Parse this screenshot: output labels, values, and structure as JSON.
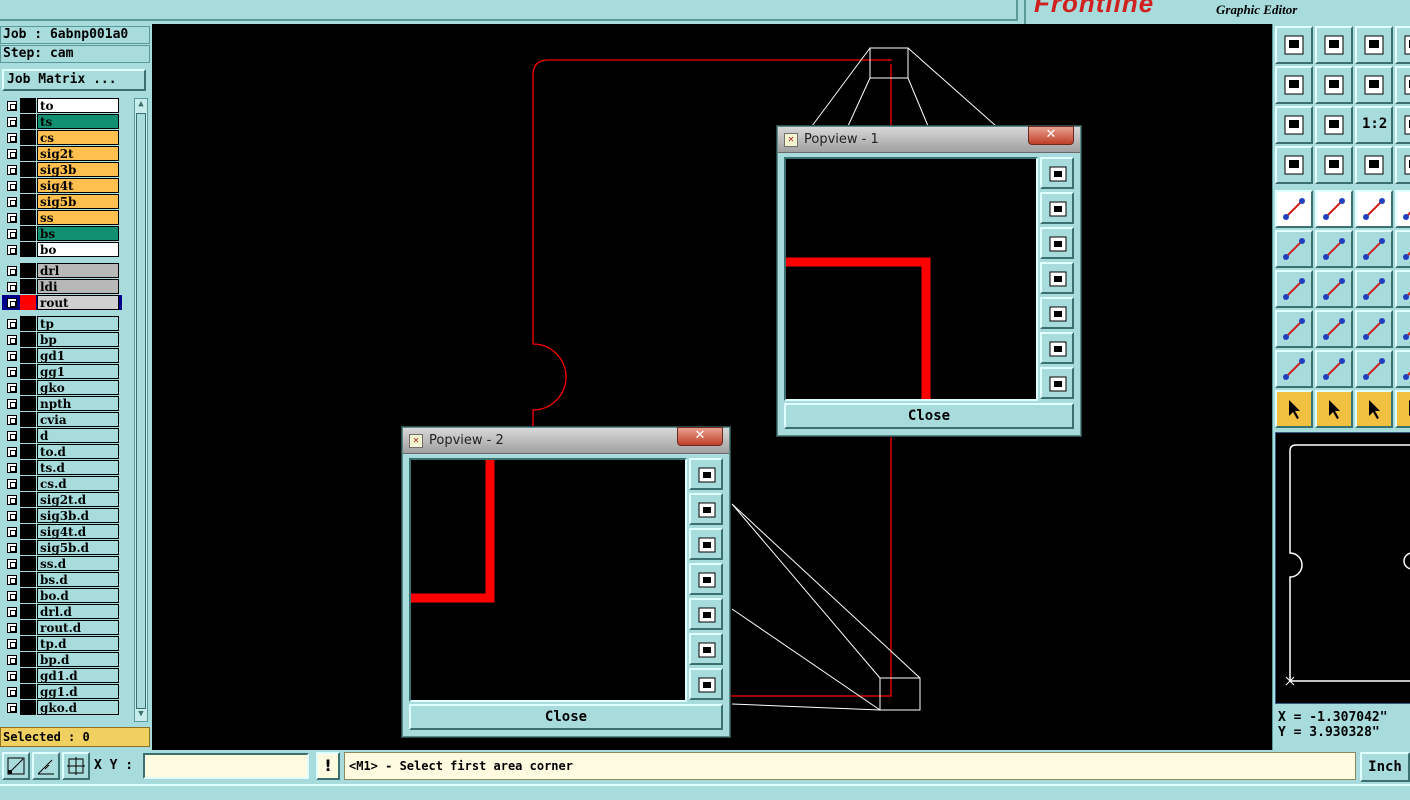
{
  "topbar": {
    "brand_logo": "Frontline",
    "brand_title": "Graphic Editor"
  },
  "left_panel": {
    "job_label": "Job : 6abnp001a0",
    "step_label": "Step: cam",
    "job_matrix_button": "Job Matrix ...",
    "selected_label": "Selected : 0",
    "layers": [
      {
        "name": "to",
        "color": "#ffffff"
      },
      {
        "name": "ts",
        "color": "#109070"
      },
      {
        "name": "cs",
        "color": "#ffc050"
      },
      {
        "name": "sig2t",
        "color": "#ffc050"
      },
      {
        "name": "sig3b",
        "color": "#ffc050"
      },
      {
        "name": "sig4t",
        "color": "#ffc050"
      },
      {
        "name": "sig5b",
        "color": "#ffc050"
      },
      {
        "name": "ss",
        "color": "#ffc050"
      },
      {
        "name": "bs",
        "color": "#109070"
      },
      {
        "name": "bo",
        "color": "#ffffff"
      },
      {
        "name": "drl",
        "color": "#b8b8b8",
        "gap_before": true
      },
      {
        "name": "ldi",
        "color": "#b8b8b8"
      },
      {
        "name": "rout",
        "color": "#d0d0d0",
        "active": true,
        "swatch": "#ff0000"
      },
      {
        "name": "tp",
        "color": "#a8dcdc",
        "gap_before": true
      },
      {
        "name": "bp",
        "color": "#a8dcdc"
      },
      {
        "name": "gd1",
        "color": "#a8dcdc"
      },
      {
        "name": "gg1",
        "color": "#a8dcdc"
      },
      {
        "name": "gko",
        "color": "#a8dcdc"
      },
      {
        "name": "npth",
        "color": "#a8dcdc"
      },
      {
        "name": "cvia",
        "color": "#a8dcdc"
      },
      {
        "name": "d",
        "color": "#a8dcdc"
      },
      {
        "name": "to.d",
        "color": "#a8dcdc"
      },
      {
        "name": "ts.d",
        "color": "#a8dcdc"
      },
      {
        "name": "cs.d",
        "color": "#a8dcdc"
      },
      {
        "name": "sig2t.d",
        "color": "#a8dcdc"
      },
      {
        "name": "sig3b.d",
        "color": "#a8dcdc"
      },
      {
        "name": "sig4t.d",
        "color": "#a8dcdc"
      },
      {
        "name": "sig5b.d",
        "color": "#a8dcdc"
      },
      {
        "name": "ss.d",
        "color": "#a8dcdc"
      },
      {
        "name": "bs.d",
        "color": "#a8dcdc"
      },
      {
        "name": "bo.d",
        "color": "#a8dcdc"
      },
      {
        "name": "drl.d",
        "color": "#a8dcdc"
      },
      {
        "name": "rout.d",
        "color": "#a8dcdc"
      },
      {
        "name": "tp.d",
        "color": "#a8dcdc"
      },
      {
        "name": "bp.d",
        "color": "#a8dcdc"
      },
      {
        "name": "gd1.d",
        "color": "#a8dcdc"
      },
      {
        "name": "gg1.d",
        "color": "#a8dcdc"
      },
      {
        "name": "gko.d",
        "color": "#a8dcdc"
      }
    ]
  },
  "popview1": {
    "title": "Popview - 1",
    "close_label": "Close"
  },
  "popview2": {
    "title": "Popview - 2",
    "close_label": "Close"
  },
  "right_panel": {
    "x_readout": "X = -1.307042\"",
    "y_readout": "Y = 3.930328\"",
    "zoom_label": "1:2"
  },
  "bottom_bar": {
    "xy_label": "X Y :",
    "xy_value": "",
    "alert_label": "!",
    "prompt": "<M1> - Select first area corner",
    "units": "Inch"
  },
  "colors": {
    "panel": "#a8dcdc",
    "rout_line": "#ff0000",
    "canvas": "#000000"
  }
}
